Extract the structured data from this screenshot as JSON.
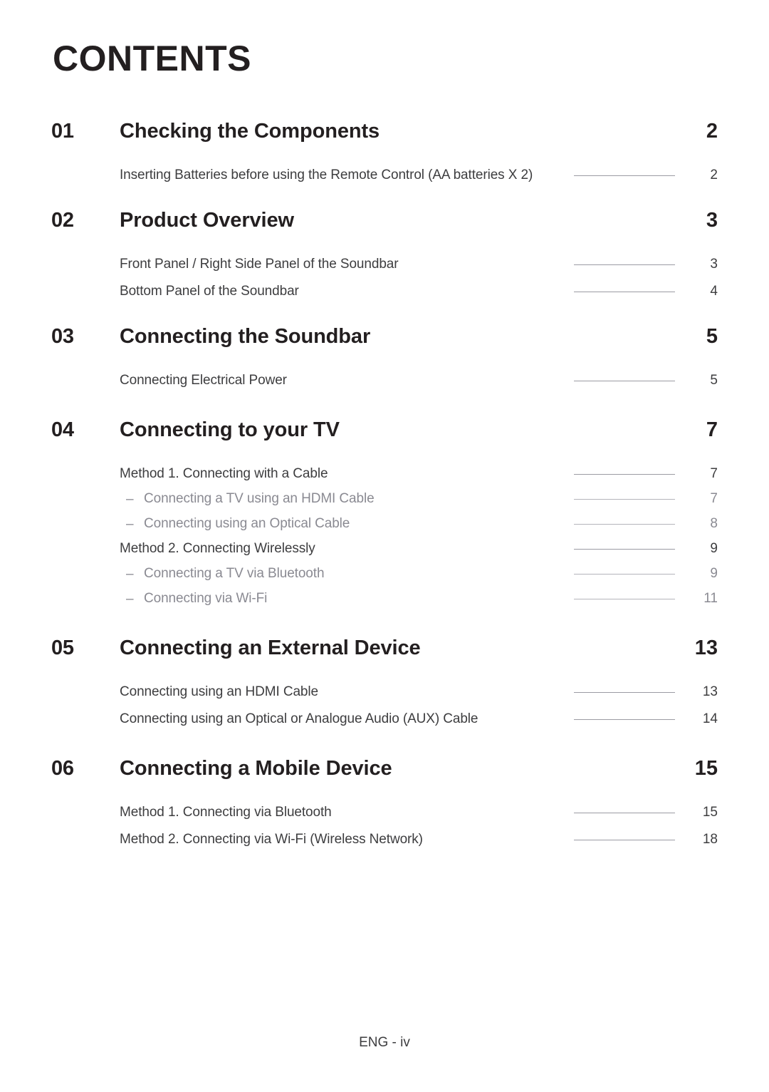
{
  "page": {
    "title": "CONTENTS",
    "footer": "ENG - iv"
  },
  "sections": [
    {
      "number": "01",
      "title": "Checking the Components",
      "page": "2",
      "entries": [
        {
          "level": 1,
          "label": "Inserting Batteries before using the Remote Control (AA batteries X 2)",
          "page": "2"
        }
      ]
    },
    {
      "number": "02",
      "title": "Product Overview",
      "page": "3",
      "entries": [
        {
          "level": 1,
          "label": "Front Panel / Right Side Panel of the Soundbar",
          "page": "3"
        },
        {
          "level": 1,
          "label": "Bottom Panel of the Soundbar",
          "page": "4"
        }
      ]
    },
    {
      "number": "03",
      "title": "Connecting the Soundbar",
      "page": "5",
      "entries": [
        {
          "level": 1,
          "label": "Connecting Electrical Power",
          "page": "5"
        }
      ]
    },
    {
      "number": "04",
      "title": "Connecting to your TV",
      "page": "7",
      "entries": [
        {
          "level": 1,
          "label": "Method 1. Connecting with a Cable",
          "page": "7"
        },
        {
          "level": 2,
          "bullet": "–",
          "label": "Connecting a TV using an HDMI Cable",
          "page": "7"
        },
        {
          "level": 2,
          "bullet": "–",
          "label": "Connecting using an Optical Cable",
          "page": "8"
        },
        {
          "level": 1,
          "label": "Method 2. Connecting Wirelessly",
          "page": "9"
        },
        {
          "level": 2,
          "bullet": "–",
          "label": "Connecting a TV via Bluetooth",
          "page": "9"
        },
        {
          "level": 2,
          "bullet": "–",
          "label": "Connecting via Wi-Fi",
          "page": "11"
        }
      ]
    },
    {
      "number": "05",
      "title": "Connecting an External Device",
      "page": "13",
      "entries": [
        {
          "level": 1,
          "label": "Connecting using an HDMI Cable",
          "page": "13"
        },
        {
          "level": 1,
          "label": "Connecting using an Optical or Analogue Audio (AUX) Cable",
          "page": "14"
        }
      ]
    },
    {
      "number": "06",
      "title": "Connecting a Mobile Device",
      "page": "15",
      "entries": [
        {
          "level": 1,
          "label": "Method 1. Connecting via Bluetooth",
          "page": "15"
        },
        {
          "level": 1,
          "label": "Method 2. Connecting via Wi-Fi (Wireless Network)",
          "page": "18"
        }
      ]
    }
  ]
}
